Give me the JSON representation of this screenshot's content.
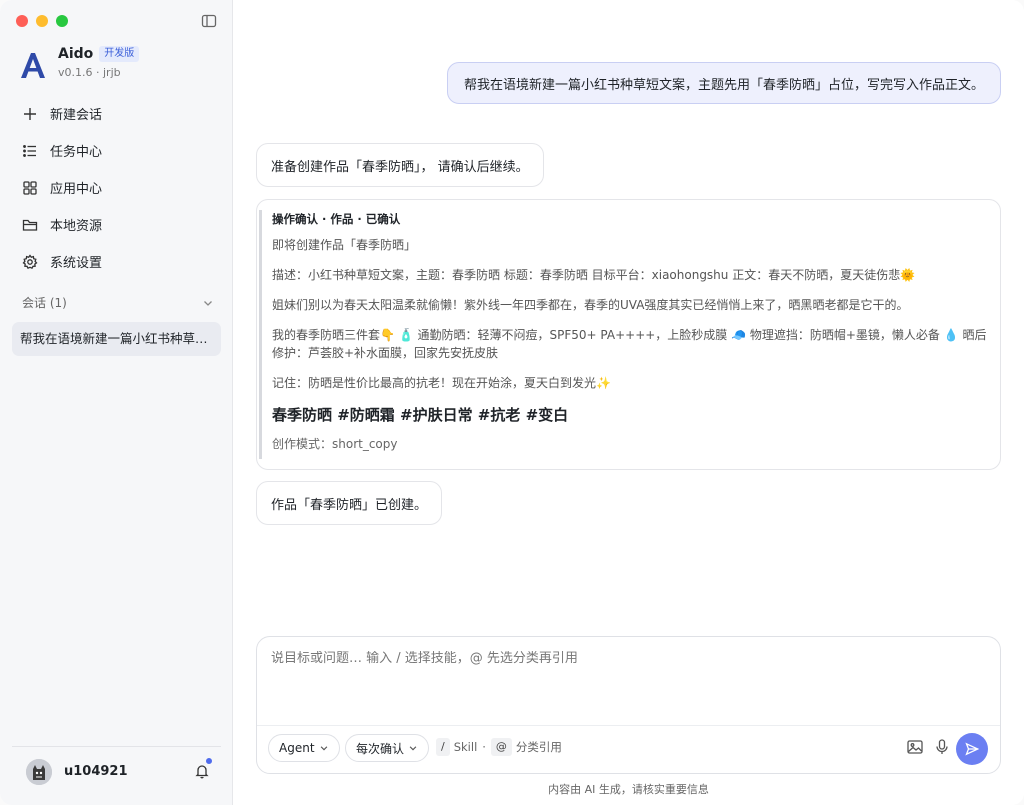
{
  "app": {
    "name": "Aido",
    "badge": "开发版",
    "version": "v0.1.6 · jrjb"
  },
  "nav": [
    {
      "label": "新建会话",
      "icon": "plus-icon"
    },
    {
      "label": "任务中心",
      "icon": "list-icon"
    },
    {
      "label": "应用中心",
      "icon": "grid-icon"
    },
    {
      "label": "本地资源",
      "icon": "folder-icon"
    },
    {
      "label": "系统设置",
      "icon": "gear-icon"
    }
  ],
  "sessions": {
    "header": "会话 (1)",
    "items": [
      "帮我在语境新建一篇小红书种草短文案，主题先用「春季防晒」占位，写完写入作品正文。"
    ]
  },
  "user": {
    "name": "u104921"
  },
  "chat": {
    "user_message": "帮我在语境新建一篇小红书种草短文案，主题先用「春季防晒」占位，写完写入作品正文。",
    "bot_message_1": "准备创建作品「春季防晒」，  请确认后继续。",
    "card": {
      "title": "操作确认 · 作品 · 已确认",
      "line1": "即将创建作品「春季防晒」",
      "line2": "描述：小红书种草短文案，主题：春季防晒 标题：春季防晒 目标平台：xiaohongshu 正文：春天不防晒，夏天徒伤悲🌞",
      "line3": "姐妹们别以为春天太阳温柔就偷懒！紫外线一年四季都在，春季的UVA强度其实已经悄悄上来了，晒黑晒老都是它干的。",
      "line4": "我的春季防晒三件套👇 🧴 通勤防晒：轻薄不闷痘，SPF50+ PA++++，上脸秒成膜 🧢 物理遮挡：防晒帽+墨镜，懒人必备 💧 晒后修护：芦荟胶+补水面膜，回家先安抚皮肤",
      "line5": "记住：防晒是性价比最高的抗老！现在开始涂，夏天白到发光✨",
      "tags": "春季防晒 #防晒霜 #护肤日常 #抗老 #变白",
      "mode": "创作模式：short_copy"
    },
    "bot_message_2": "作品「春季防晒」已创建。"
  },
  "composer": {
    "placeholder": "说目标或问题… 输入 / 选择技能，@ 先选分类再引用",
    "agent_label": "Agent",
    "confirm_label": "每次确认",
    "slash_key": "/",
    "skill_label": "Skill",
    "dot": "·",
    "at_key": "@",
    "at_label": "分类引用"
  },
  "footer": "内容由 AI 生成，请核实重要信息",
  "colors": {
    "accent": "#6b7ff2",
    "user_bubble_bg": "#eef0fd",
    "sidebar_bg": "#f6f7f9"
  }
}
